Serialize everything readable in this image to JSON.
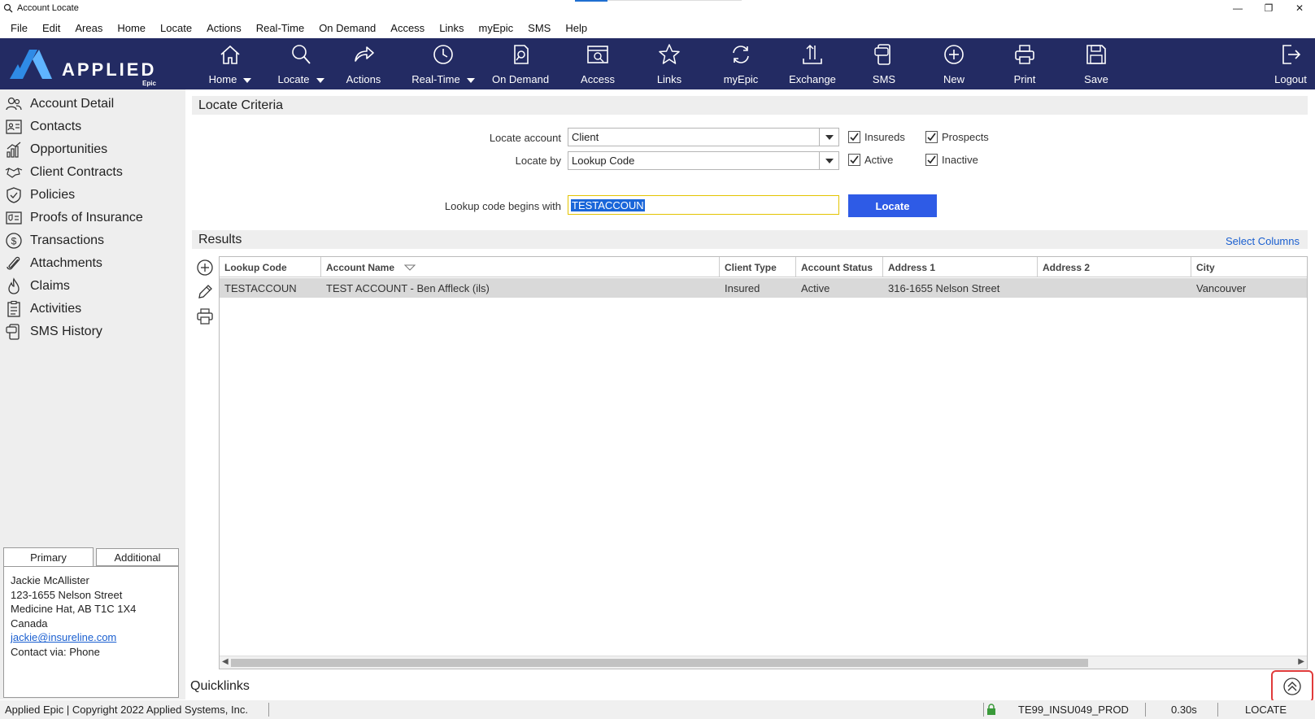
{
  "window": {
    "title": "Account Locate"
  },
  "menu": [
    "File",
    "Edit",
    "Areas",
    "Home",
    "Locate",
    "Actions",
    "Real-Time",
    "On Demand",
    "Access",
    "Links",
    "myEpic",
    "SMS",
    "Help"
  ],
  "logo": {
    "text": "APPLIED",
    "sub": "Epic"
  },
  "toolbar": {
    "home": "Home",
    "locate": "Locate",
    "actions": "Actions",
    "realtime": "Real-Time",
    "ondemand": "On Demand",
    "access": "Access",
    "links": "Links",
    "myepic": "myEpic",
    "exchange": "Exchange",
    "sms": "SMS",
    "new": "New",
    "print": "Print",
    "save": "Save",
    "logout": "Logout"
  },
  "sidebar": {
    "items": [
      "Account Detail",
      "Contacts",
      "Opportunities",
      "Client Contracts",
      "Policies",
      "Proofs of Insurance",
      "Transactions",
      "Attachments",
      "Claims",
      "Activities",
      "SMS History"
    ]
  },
  "contact": {
    "tab_primary": "Primary",
    "tab_additional": "Additional",
    "name": "Jackie McAllister",
    "street": "123-1655 Nelson Street",
    "city": "Medicine Hat, AB  T1C  1X4",
    "country": "Canada",
    "email": "jackie@insureline.com",
    "contact_via": "Contact via: Phone"
  },
  "criteria": {
    "header": "Locate Criteria",
    "locate_account_label": "Locate account",
    "locate_account_value": "Client",
    "locate_by_label": "Locate by",
    "locate_by_value": "Lookup Code",
    "insureds": "Insureds",
    "prospects": "Prospects",
    "active": "Active",
    "inactive": "Inactive",
    "lookup_label": "Lookup code begins with",
    "lookup_value": "TESTACCOUN",
    "locate_button": "Locate"
  },
  "results": {
    "header": "Results",
    "select_columns": "Select Columns",
    "columns": [
      "Lookup Code",
      "Account Name",
      "Client Type",
      "Account Status",
      "Address 1",
      "Address 2",
      "City"
    ],
    "rows": [
      [
        "TESTACCOUN",
        "TEST ACCOUNT - Ben Affleck (ils)",
        "Insured",
        "Active",
        "316-1655 Nelson Street",
        "",
        "Vancouver"
      ]
    ]
  },
  "quicklinks": "Quicklinks",
  "status": {
    "copyright": "Applied Epic | Copyright 2022 Applied Systems, Inc.",
    "database": "TE99_INSU049_PROD",
    "time": "0.30s",
    "mode": "LOCATE"
  },
  "colors": {
    "toolbar_bg": "#232b63",
    "accent": "#2e5be6",
    "logo_blue": "#2f8be6"
  }
}
